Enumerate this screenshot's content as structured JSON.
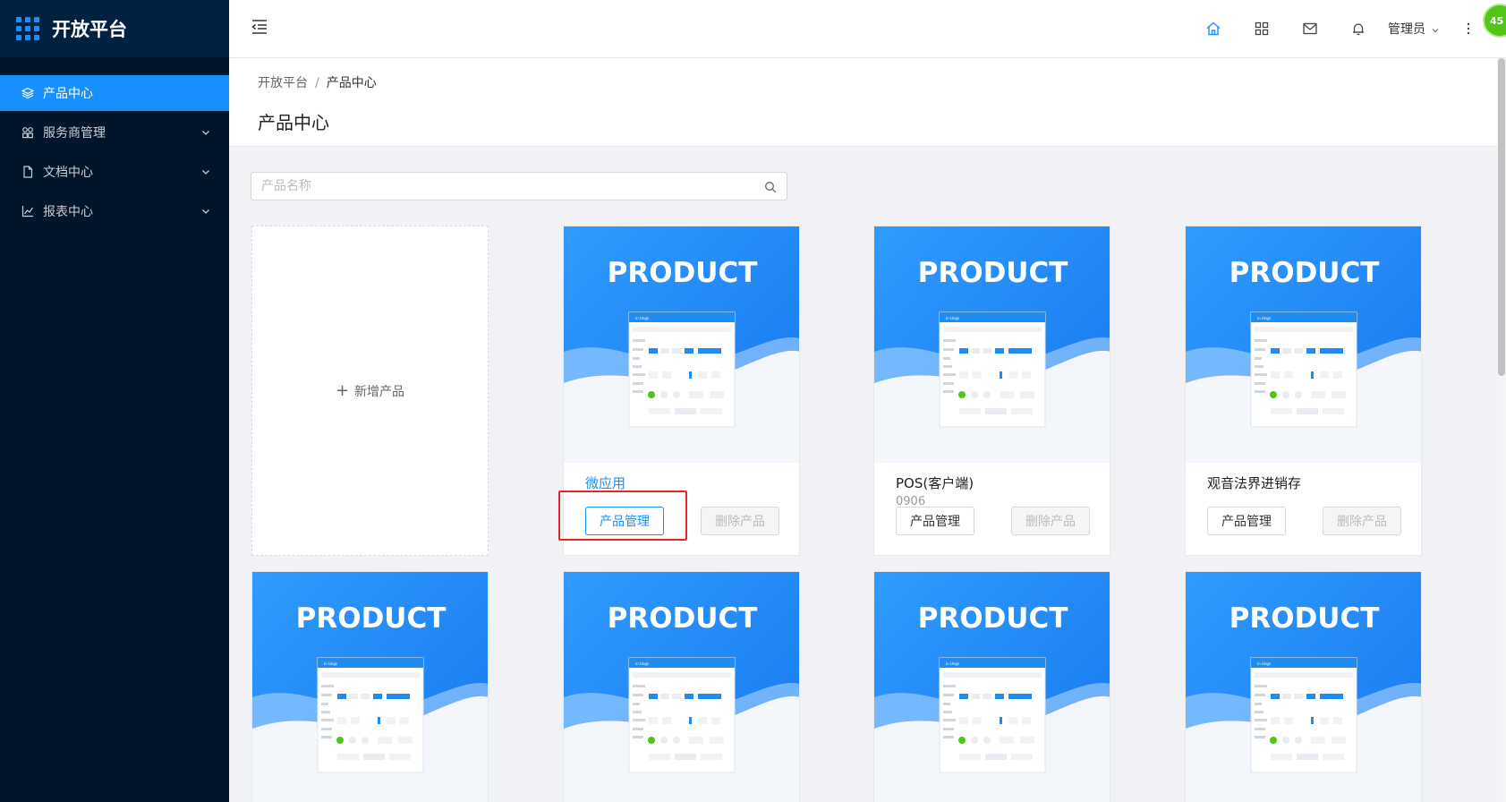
{
  "brand": {
    "title": "开放平台",
    "accent": "#1890ff"
  },
  "sidebar": {
    "items": [
      {
        "label": "产品中心",
        "icon": "layers-icon",
        "active": true
      },
      {
        "label": "服务商管理",
        "icon": "apps-icon",
        "expandable": true
      },
      {
        "label": "文档中心",
        "icon": "file-icon",
        "expandable": true
      },
      {
        "label": "报表中心",
        "icon": "chart-icon",
        "expandable": true
      }
    ]
  },
  "header": {
    "icons": [
      "home-icon",
      "grid-icon",
      "mail-icon",
      "bell-icon"
    ],
    "user": "管理员",
    "avatar_badge": "45"
  },
  "breadcrumb": {
    "root": "开放平台",
    "sep": "/",
    "current": "产品中心"
  },
  "page": {
    "title": "产品中心"
  },
  "search": {
    "placeholder": "产品名称"
  },
  "add_card": {
    "label": "新增产品"
  },
  "cover": {
    "banner_text": "PRODUCT",
    "mock_title": "in Ungs"
  },
  "products": [
    {
      "name": "微应用",
      "sub": "",
      "manage_label": "产品管理",
      "delete_label": "删除产品",
      "highlighted": true
    },
    {
      "name": "POS(客户端)",
      "sub": "0906",
      "manage_label": "产品管理",
      "delete_label": "删除产品"
    },
    {
      "name": "观音法界进销存",
      "sub": "",
      "manage_label": "产品管理",
      "delete_label": "删除产品"
    },
    {
      "name": "",
      "sub": ""
    },
    {
      "name": "",
      "sub": ""
    },
    {
      "name": "",
      "sub": ""
    },
    {
      "name": "",
      "sub": ""
    }
  ]
}
